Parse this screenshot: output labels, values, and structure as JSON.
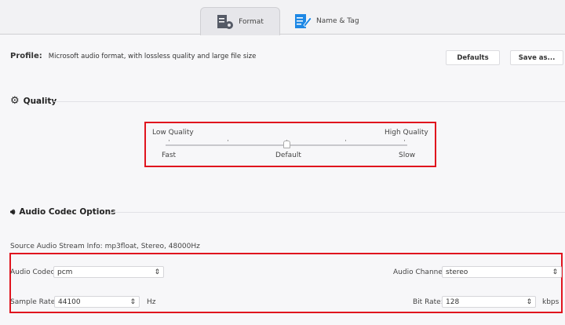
{
  "tabs": [
    {
      "label": "Format",
      "icon": "format-settings-icon",
      "active": true
    },
    {
      "label": "Name & Tag",
      "icon": "edit-tag-icon",
      "active": false
    }
  ],
  "profile": {
    "label": "Profile:",
    "description": "Microsoft audio format, with lossless quality and large file size"
  },
  "buttons": {
    "defaults": "Defaults",
    "save_as": "Save as..."
  },
  "quality": {
    "title": "Quality",
    "low": "Low Quality",
    "high": "High Quality",
    "fast": "Fast",
    "default": "Default",
    "slow": "Slow",
    "slider_value": 0.5,
    "ticks": 5
  },
  "audio": {
    "title": "Audio Codec Options",
    "source_info": "Source Audio Stream Info: mp3float, Stereo, 48000Hz",
    "codec_label": "Audio Codec:",
    "codec_value": "pcm",
    "channel_label": "Audio Channel:",
    "channel_value": "stereo",
    "sample_label": "Sample Rate:",
    "sample_value": "44100",
    "sample_unit": "Hz",
    "bitrate_label": "Bit Rate:",
    "bitrate_value": "128",
    "bitrate_unit": "kbps"
  },
  "colors": {
    "highlight": "#e0141e",
    "tab_icon_blue": "#1e88e5"
  }
}
